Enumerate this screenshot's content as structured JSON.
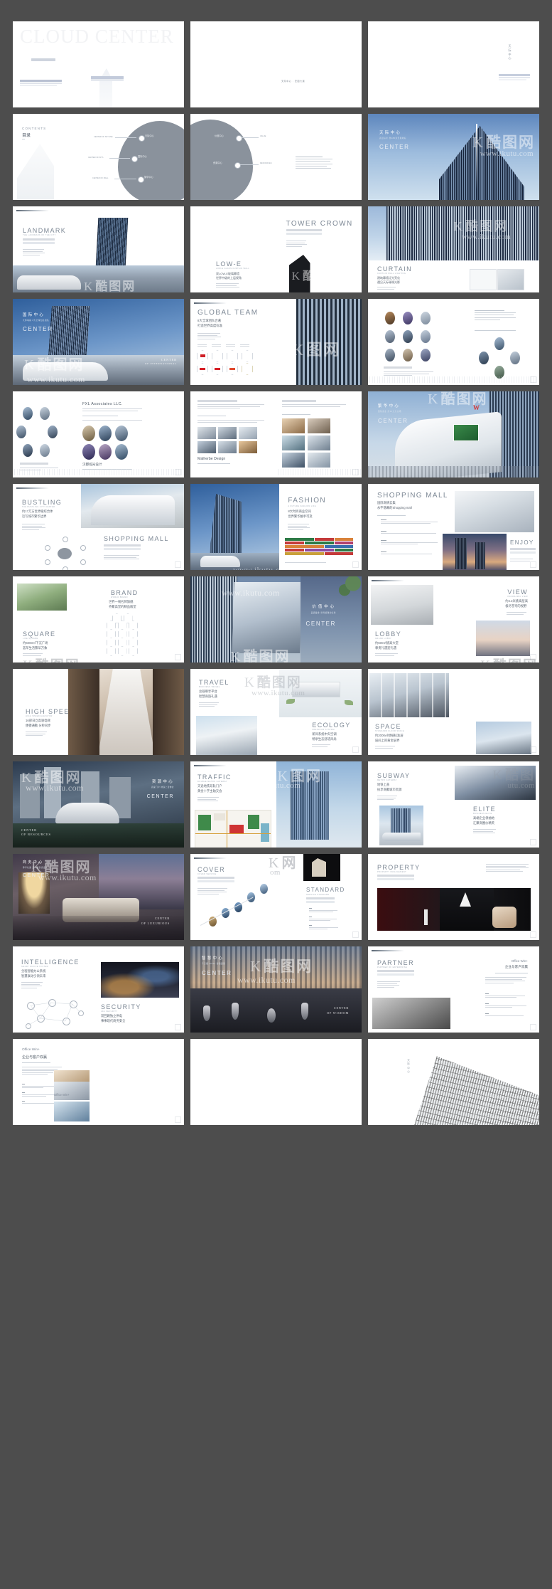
{
  "document": {
    "title": "CLOUD CENTER",
    "brand_cn": "天际中心",
    "brand_en": "CENTER",
    "watermark_url": "www.ikutu.com",
    "watermark_cn": "酷图网",
    "background_color": "#4d4d4d",
    "page_color": "#ffffff",
    "columns": 3,
    "rows": 12,
    "total_pages": 36
  },
  "pages": [
    {
      "n": 1,
      "kind": "cover",
      "title_en": "CLOUD CENTER",
      "title_cn": "",
      "sub_en": "",
      "sub_cn": ""
    },
    {
      "n": 2,
      "kind": "blank",
      "title_en": "",
      "title_cn": "",
      "sub_en": "",
      "sub_cn": ""
    },
    {
      "n": 3,
      "kind": "inner-cover",
      "title_en": "",
      "title_cn": "天际中心",
      "sub_en": "",
      "sub_cn": ""
    },
    {
      "n": 4,
      "kind": "contents",
      "title_en": "CONTENTS",
      "title_cn": "目录",
      "sub_en": "",
      "sub_cn": ""
    },
    {
      "n": 5,
      "kind": "contents-b",
      "title_en": "",
      "title_cn": "",
      "sub_en": "",
      "sub_cn": ""
    },
    {
      "n": 6,
      "kind": "hero-sky",
      "title_en": "CENTER",
      "title_cn": "天际中心",
      "sub_en": "",
      "sub_cn": "高层标杆 约180米天幕地标"
    },
    {
      "n": 7,
      "kind": "landmark",
      "title_en": "LANDMARK",
      "title_cn": "",
      "sub_en": "THE LANDMARK OF THE CITY",
      "sub_cn": ""
    },
    {
      "n": 8,
      "kind": "lowe",
      "title_en": "LOW-E",
      "title_cn": "",
      "sub_en": "LOW-E GLASS CURTAIN WALL",
      "sub_cn": "双LOW-E玻璃幕墙 世界中级的上层视角"
    },
    {
      "n": 9,
      "kind": "crown",
      "title_en": "TOWER CROWN",
      "title_cn": "",
      "sub_en": "",
      "sub_cn": ""
    },
    {
      "n": 10,
      "kind": "curtain",
      "title_en": "CURTAIN",
      "title_cn": "",
      "sub_en": "",
      "sub_cn": "建筑幕墙泛光亮化 遇见天际璀璨光影"
    },
    {
      "n": 11,
      "kind": "hero-intl",
      "title_en": "CENTER",
      "title_cn": "国际中心",
      "sub_en": "CENTER OF INTERNATIONAL",
      "sub_cn": "大师联袂 8大全球知名团队"
    },
    {
      "n": 12,
      "kind": "globalteam",
      "title_en": "GLOBAL TEAM",
      "title_cn": "",
      "sub_en": "",
      "sub_cn": "8大全球团队合著 打造世界高度标准"
    },
    {
      "n": 13,
      "kind": "glass-photo",
      "title_en": "",
      "title_cn": "",
      "sub_en": "",
      "sub_cn": ""
    },
    {
      "n": 14,
      "kind": "ovalgrid",
      "title_en": "",
      "title_cn": "",
      "sub_en": "",
      "sub_cn": ""
    },
    {
      "n": 15,
      "kind": "fxl",
      "title_en": "FXL Associates LLC.",
      "title_cn": "汉都控光设计",
      "sub_en": "",
      "sub_cn": ""
    },
    {
      "n": 16,
      "kind": "malherbe",
      "title_en": "Malherbe Design",
      "title_cn": "",
      "sub_en": "",
      "sub_cn": ""
    },
    {
      "n": 17,
      "kind": "hero-mall",
      "title_en": "CENTER",
      "title_cn": "繁华中心",
      "sub_en": "",
      "sub_cn": "国际商业 约13万方主场"
    },
    {
      "n": 18,
      "kind": "bustling",
      "title_en": "BUSTLING",
      "title_cn": "",
      "sub_en": "SHOPPING MALL",
      "sub_cn": "约17万方世界级综合体 近写城市繁华边界"
    },
    {
      "n": 19,
      "kind": "fashion",
      "title_en": "FASHION",
      "title_cn": "",
      "sub_en": "",
      "sub_cn": "8大时尚商业空间 世界繁华触手可及"
    },
    {
      "n": 20,
      "kind": "shopmall",
      "title_en": "SHOPPING MALL",
      "title_cn": "",
      "sub_en": "ENJOY",
      "sub_cn": "国际商情云集 永不落幕的Shopping mall"
    },
    {
      "n": 21,
      "kind": "brand",
      "title_en": "BRAND",
      "title_cn": "",
      "sub_en": "SQUARE",
      "sub_cn": "世界一线名牌旗舰 齐聚高堂的精品殿堂"
    },
    {
      "n": 22,
      "kind": "hero-value",
      "title_en": "CENTER",
      "title_cn": "价值中心",
      "sub_en": "",
      "sub_cn": "品质臻金 世界璀璨的标准"
    },
    {
      "n": 23,
      "kind": "lobby",
      "title_en": "LOBBY",
      "title_cn": "",
      "sub_en": "VIEW",
      "sub_cn": "约600㎡挑高大堂 尊贵礼遇迎礼遇"
    },
    {
      "n": 24,
      "kind": "highspeed",
      "title_en": "HIGH SPEED",
      "title_cn": "",
      "sub_en": "",
      "sub_cn": "16部日立高速电梯 便捷通勤 分秒同步"
    },
    {
      "n": 25,
      "kind": "travel",
      "title_en": "TRAVEL",
      "title_cn": "",
      "sub_en": "ECOLOGY",
      "sub_cn": "总裁尊享平台 智慧商旅礼遇"
    },
    {
      "n": 26,
      "kind": "space",
      "title_en": "SPACE",
      "title_cn": "",
      "sub_en": "",
      "sub_cn": "约2000㎡绿植标准层 层间上的黄金层界"
    },
    {
      "n": 27,
      "kind": "hero-res",
      "title_en": "CENTER OF RESOURCES",
      "title_cn": "资源中心",
      "sub_en": "",
      "sub_cn": "高速门户 地铁上盖物业"
    },
    {
      "n": 28,
      "kind": "traffic",
      "title_en": "TRAFFIC",
      "title_cn": "",
      "sub_en": "",
      "sub_cn": "天途地铁双轨门户 黄金十字主轴交会"
    },
    {
      "n": 29,
      "kind": "subway",
      "title_en": "SUBWAY",
      "title_cn": "",
      "sub_en": "ELITE",
      "sub_cn": "地铁上盖 执享商聚城市资源"
    },
    {
      "n": 30,
      "kind": "hero-biz",
      "title_en": "CENTER",
      "title_cn": "商务中心",
      "sub_en": "LUXURIOUS",
      "sub_cn": ""
    },
    {
      "n": 31,
      "kind": "cover-std",
      "title_en": "COVER",
      "title_cn": "",
      "sub_en": "STANDARD",
      "sub_cn": ""
    },
    {
      "n": 32,
      "kind": "property",
      "title_en": "PROPERTY",
      "title_cn": "",
      "sub_en": "",
      "sub_cn": ""
    },
    {
      "n": 33,
      "kind": "intelligence",
      "title_en": "INTELLIGENCE",
      "title_cn": "",
      "sub_en": "SECURITY",
      "sub_cn": "全程智能办公系统 智慧联动引领未来"
    },
    {
      "n": 34,
      "kind": "hero-wisdom",
      "title_en": "CENTER",
      "title_cn": "智慧中心",
      "sub_en": "CENTER OF WISDOM",
      "sub_cn": "千万级 office 智慧运营"
    },
    {
      "n": 35,
      "kind": "partner",
      "title_en": "PARTNER",
      "title_cn": "企业与客户双赢",
      "sub_en": "Office Win+",
      "sub_cn": ""
    },
    {
      "n": 36,
      "kind": "officewin",
      "title_en": "Office Win+",
      "title_cn": "企业与客户双赢",
      "sub_en": "",
      "sub_cn": ""
    },
    {
      "n": 37,
      "kind": "blank",
      "title_en": "",
      "title_cn": "",
      "sub_en": "",
      "sub_cn": ""
    },
    {
      "n": 38,
      "kind": "backcover",
      "title_en": "",
      "title_cn": "天际中心",
      "sub_en": "",
      "sub_cn": ""
    }
  ],
  "labels": {
    "contents_en": "CONTENTS",
    "contents_cn": "目录",
    "hero_center": "CENTER",
    "global_team": "GLOBAL TEAM",
    "fxl": "FXL Associates LLC.",
    "malherbe": "Malherbe Design",
    "landmark": "LANDMARK",
    "lowe": "LOW-E",
    "tower_crown": "TOWER CROWN",
    "curtain": "CURTAIN",
    "bustling": "BUSTLING",
    "shopping_mall": "SHOPPING MALL",
    "fashion": "FASHION",
    "enjoy": "ENJOY",
    "brand": "BRAND",
    "square": "SQUARE",
    "lobby": "LOBBY",
    "view": "VIEW",
    "high_speed": "HIGH SPEED",
    "travel": "TRAVEL",
    "ecology": "ECOLOGY",
    "space": "SPACE",
    "traffic": "TRAFFIC",
    "subway": "SUBWAY",
    "elite": "ELITE",
    "cover": "COVER",
    "standard": "STANDARD",
    "property": "PROPERTY",
    "intelligence": "INTELLIGENCE",
    "security": "SECURITY",
    "partner": "PARTNER",
    "office_win": "Office Win+",
    "cn_skyline": "天际中心",
    "cn_international": "国际中心",
    "cn_bustling": "繁华中心",
    "cn_value": "价值中心",
    "cn_resources": "资源中心",
    "cn_business": "商务中心",
    "cn_wisdom": "智慧中心",
    "cover_title": "CLOUD CENTER"
  }
}
